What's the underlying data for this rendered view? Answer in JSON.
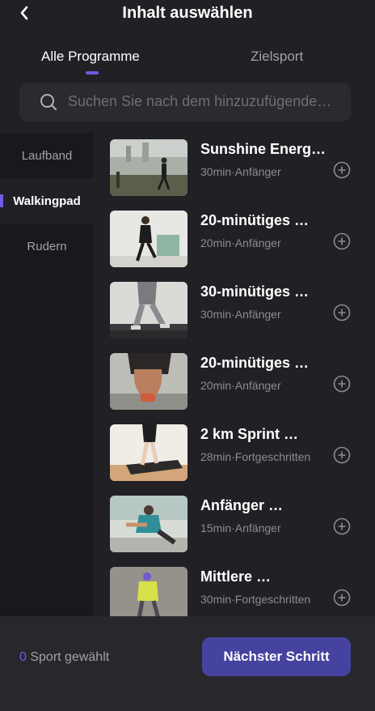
{
  "header": {
    "title": "Inhalt auswählen",
    "back_icon": "chevron-left-icon"
  },
  "tabs": [
    {
      "label": "Alle Programme",
      "active": true
    },
    {
      "label": "Zielsport",
      "active": false
    }
  ],
  "search": {
    "placeholder": "Suchen Sie nach dem hinzuzufügende…",
    "icon": "search-icon"
  },
  "sidebar": {
    "items": [
      {
        "label": "Laufband",
        "active": false
      },
      {
        "label": "Walkingpad",
        "active": true
      },
      {
        "label": "Rudern",
        "active": false
      }
    ]
  },
  "programs": [
    {
      "title": "Sunshine Energ…",
      "meta": "30min·Anfänger"
    },
    {
      "title": "20-minütiges …",
      "meta": "20min·Anfänger"
    },
    {
      "title": "30-minütiges …",
      "meta": "30min·Anfänger"
    },
    {
      "title": "20-minütiges …",
      "meta": "20min·Anfänger"
    },
    {
      "title": "2 km Sprint …",
      "meta": "28min·Fortgeschritten"
    },
    {
      "title": "Anfänger …",
      "meta": "15min·Anfänger"
    },
    {
      "title": "Mittlere …",
      "meta": "30min·Fortgeschritten"
    }
  ],
  "footer": {
    "count": "0",
    "count_label": " Sport gewählt",
    "next_button": "Nächster Schritt"
  },
  "colors": {
    "accent": "#6c5ce7",
    "button": "#4643a0",
    "background": "#212025",
    "sidebar": "#19181c",
    "footer": "#28272c"
  }
}
